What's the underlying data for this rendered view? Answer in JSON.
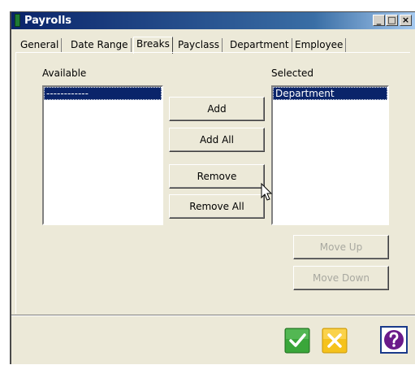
{
  "window": {
    "title": "Payrolls",
    "controls": {
      "minimize": "_",
      "maximize": "□",
      "close": "×"
    }
  },
  "tabs": [
    {
      "label": "General",
      "active": false
    },
    {
      "label": "Date Range",
      "active": false
    },
    {
      "label": "Breaks",
      "active": true
    },
    {
      "label": "Payclass",
      "active": false
    },
    {
      "label": "Department",
      "active": false
    },
    {
      "label": "Employee",
      "active": false
    }
  ],
  "available": {
    "label": "Available",
    "items": [
      "------------"
    ],
    "selected_index": 0
  },
  "selected": {
    "label": "Selected",
    "items": [
      "Department"
    ],
    "selected_index": 0
  },
  "buttons": {
    "add": "Add",
    "add_all": "Add All",
    "remove": "Remove",
    "remove_all": "Remove All",
    "move_up": "Move Up",
    "move_down": "Move Down"
  },
  "footer": {
    "ok_icon": "green-checkmark-icon",
    "cancel_icon": "yellow-x-icon",
    "help_icon": "purple-question-icon"
  },
  "colors": {
    "titlebar": "#0a246a",
    "selection": "#0a246a",
    "ok": "#3aa63a",
    "cancel": "#f5c21c",
    "help": "#6a1a8a"
  }
}
